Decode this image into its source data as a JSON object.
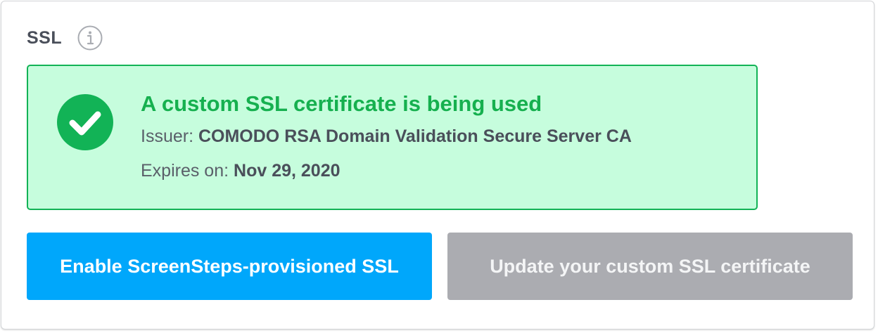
{
  "section": {
    "title": "SSL",
    "info_icon": "info-icon"
  },
  "status": {
    "icon": "check-circle-icon",
    "title": "A custom SSL certificate is being used",
    "issuer_label": "Issuer:",
    "issuer_value": "COMODO RSA Domain Validation Secure Server CA",
    "expires_label": "Expires on:",
    "expires_value": "Nov 29, 2020"
  },
  "actions": {
    "enable_label": "Enable ScreenSteps-provisioned SSL",
    "update_label": "Update your custom SSL certificate"
  },
  "colors": {
    "success_bg": "#c6fddd",
    "success_border": "#12b356",
    "success_text": "#16b04f",
    "primary_button": "#00a7fb",
    "secondary_button": "#abacb1"
  }
}
